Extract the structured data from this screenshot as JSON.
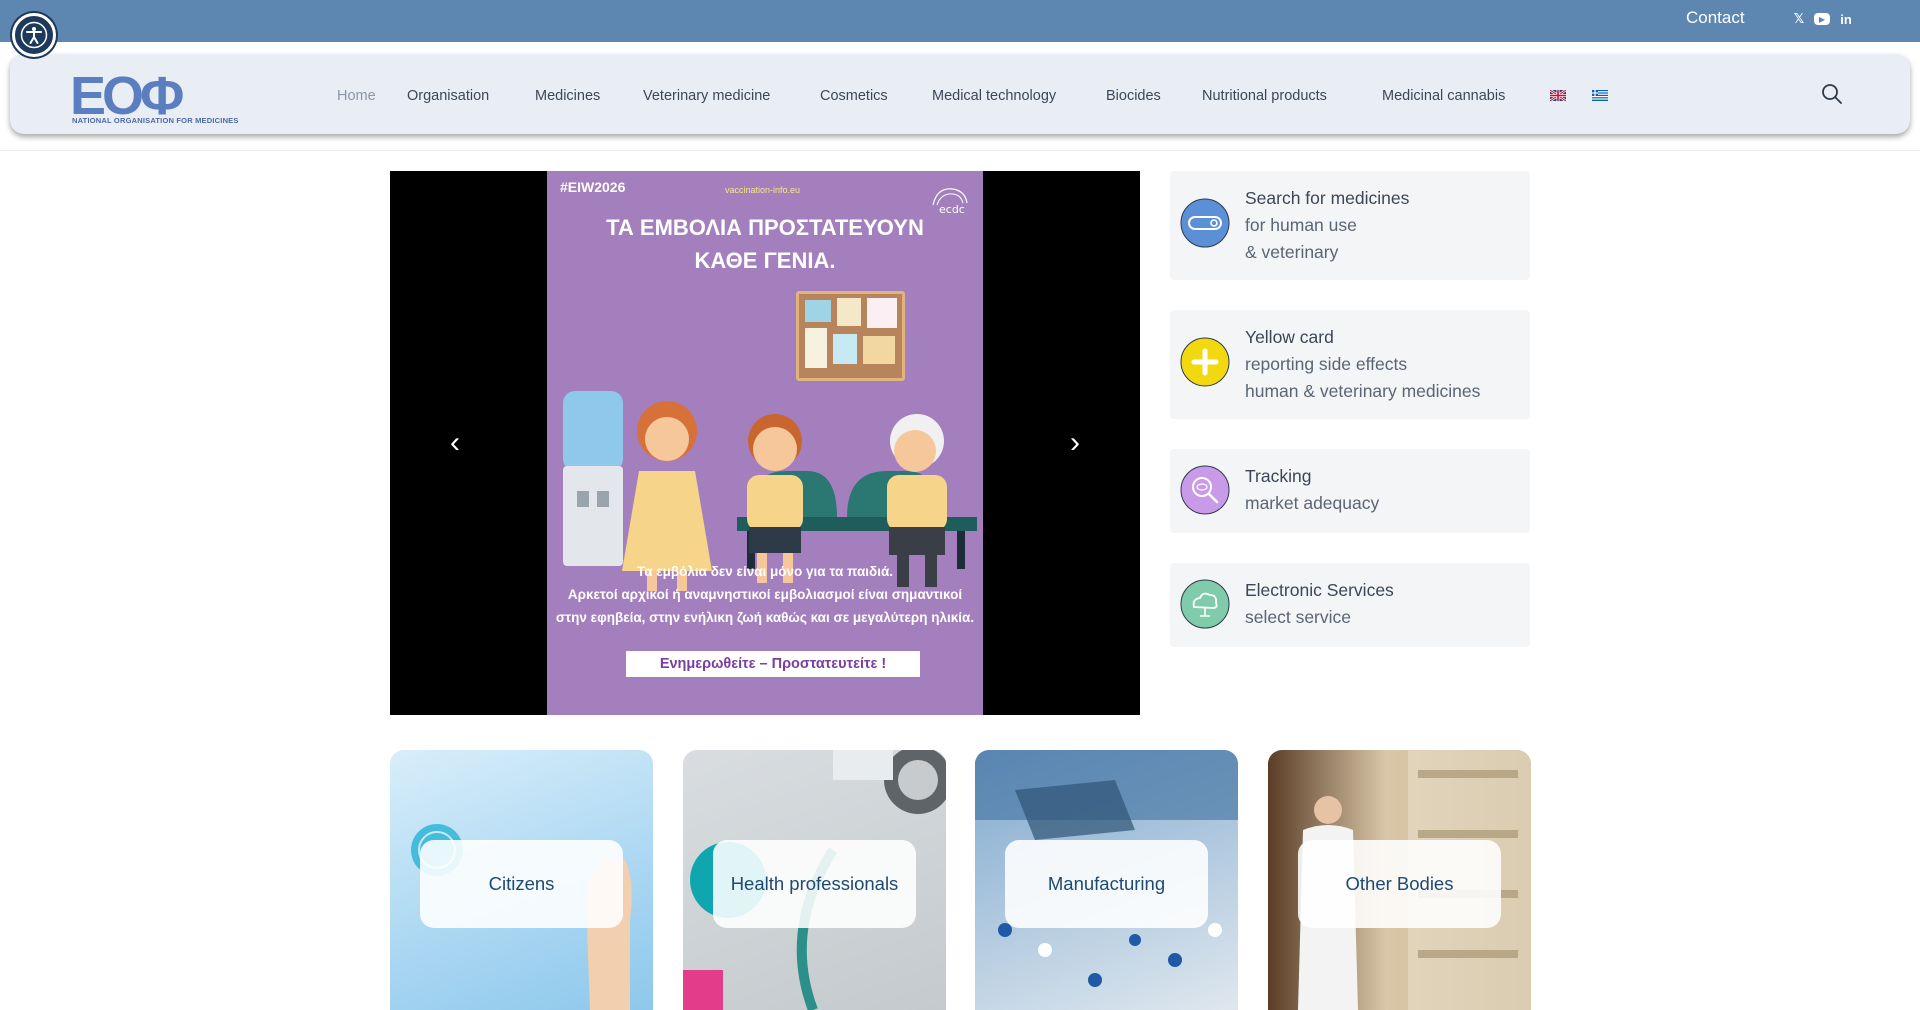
{
  "topbar": {
    "contact": "Contact",
    "social": [
      {
        "name": "x-icon",
        "glyph": "𝕏"
      },
      {
        "name": "youtube-icon",
        "glyph": "▶"
      },
      {
        "name": "linkedin-icon",
        "glyph": "in"
      }
    ]
  },
  "header": {
    "logo_text": "ΕΟΦ",
    "logo_subtitle": "NATIONAL ORGANISATION FOR MEDICINES"
  },
  "nav": {
    "items": [
      {
        "label": "Home"
      },
      {
        "label": "Organisation"
      },
      {
        "label": "Medicines"
      },
      {
        "label": "Veterinary medicine"
      },
      {
        "label": "Cosmetics"
      },
      {
        "label": "Medical technology"
      },
      {
        "label": "Biocides"
      },
      {
        "label": "Nutritional products"
      },
      {
        "label": "Medicinal cannabis"
      }
    ]
  },
  "slider": {
    "tag": "#EIW2026",
    "site": "vaccination-info.eu",
    "headline_1": "ΤΑ ΕΜΒΟΛΙΑ ΠΡΟΣΤΑΤΕΥΟΥΝ",
    "headline_2": "ΚΑΘΕ ΓΕΝΙΑ.",
    "body_1": "Τα εμβόλια δεν είναι μόνο για τα παιδιά.",
    "body_2": "Αρκετοί αρχικοί ή αναμνηστικοί εμβολιασμοί είναι σημαντικοί",
    "body_3": "στην εφηβεία, στην ενήλικη ζωή καθώς και σε μεγαλύτερη ηλικία.",
    "cta": "Ενημερωθείτε – Προστατευτείτε !",
    "prev_glyph": "‹",
    "next_glyph": "›"
  },
  "quick_links": [
    {
      "title": "Search for medicines",
      "line1": "for human use",
      "line2": "& veterinary",
      "icon": "pill-search-icon",
      "color": "#5b8fd6"
    },
    {
      "title": "Yellow card",
      "line1": "reporting side effects",
      "line2": "human & veterinary medicines",
      "icon": "yellow-card-icon",
      "color": "#f2d90f"
    },
    {
      "title": "Tracking",
      "line1": "market adequacy",
      "icon": "tracking-icon",
      "color": "#c99ae8"
    },
    {
      "title": "Electronic Services",
      "line1": "select service",
      "icon": "cloud-service-icon",
      "color": "#7fcbaa"
    }
  ],
  "tiles": [
    {
      "label": "Citizens"
    },
    {
      "label": "Health professionals"
    },
    {
      "label": "Manufacturing"
    },
    {
      "label": "Other Bodies"
    }
  ],
  "colors": {
    "topbar": "#5d87b1",
    "navbar": "#e9eef4",
    "tile_text": "#1d4a72"
  }
}
